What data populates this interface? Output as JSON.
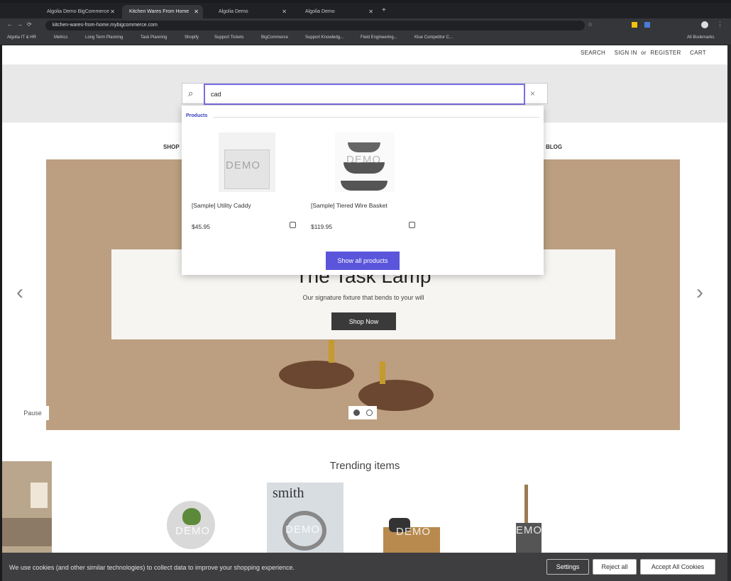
{
  "browser": {
    "tabs": [
      {
        "label": "Algolia Demo BigCommerce"
      },
      {
        "label": "Kitchen Wares From Home"
      },
      {
        "label": "Algolia Demo"
      },
      {
        "label": "Algolia Demo"
      }
    ],
    "url": "kitchen-wares-from-home.mybigcommerce.com",
    "bookmarks": [
      "Algolia IT & HR",
      "Metrics",
      "Long Term Planning",
      "Task Planning",
      "Shopify",
      "Support Tickets",
      "BigCommerce",
      "Support Knowledg...",
      "Field Engineering...",
      "Klue Competitor C..."
    ],
    "all_bookmarks": "All Bookmarks"
  },
  "topnav": {
    "search": "SEARCH",
    "signin": "SIGN IN",
    "or": "or",
    "register": "REGISTER",
    "cart": "CART"
  },
  "menu": {
    "shop": "SHOP",
    "blog": "BLOG"
  },
  "search": {
    "query": "cad",
    "clear_symbol": "×"
  },
  "dropdown": {
    "section_label": "Products",
    "products": [
      {
        "name": "[Sample] Utility Caddy",
        "price": "$45.95"
      },
      {
        "name": "[Sample] Tiered Wire Basket",
        "price": "$119.95"
      }
    ],
    "show_all": "Show all products"
  },
  "hero": {
    "title": "The Task Lamp",
    "subtitle": "Our signature fixture that bends to your will",
    "cta": "Shop Now",
    "pause": "Pause"
  },
  "trending": {
    "title": "Trending items",
    "magazine_title": "smith"
  },
  "watermark": "DEMO",
  "cookie": {
    "message": "We use cookies (and other similar technologies) to collect data to improve your shopping experience.",
    "settings": "Settings",
    "reject": "Reject all",
    "accept": "Accept All Cookies"
  }
}
